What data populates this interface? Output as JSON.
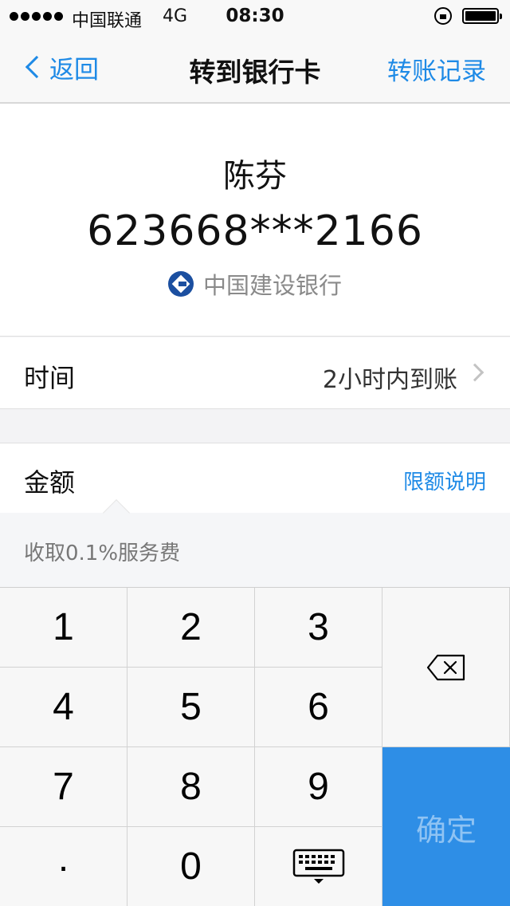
{
  "status_bar": {
    "carrier": "中国联通",
    "network": "4G",
    "time": "08:30"
  },
  "nav": {
    "back_label": "返回",
    "title": "转到银行卡",
    "records_label": "转账记录"
  },
  "payee": {
    "name": "陈芬",
    "card_number": "623668***2166",
    "bank_name": "中国建设银行",
    "bank_logo_icon": "ccb-logo-icon"
  },
  "time_row": {
    "label": "时间",
    "value": "2小时内到账"
  },
  "amount": {
    "label": "金额",
    "limit_link": "限额说明",
    "fee_note": "收取0.1%服务费"
  },
  "keypad": {
    "keys": [
      "1",
      "2",
      "3",
      "4",
      "5",
      "6",
      "7",
      "8",
      "9",
      ".",
      "0"
    ],
    "confirm_label": "确定",
    "delete_icon": "backspace-icon",
    "hide_keyboard_icon": "keyboard-hide-icon"
  },
  "colors": {
    "accent": "#1e8ae6",
    "confirm_bg": "#2e8ee6",
    "confirm_text": "#8fc3f3"
  }
}
